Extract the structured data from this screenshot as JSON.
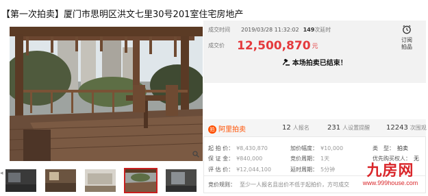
{
  "title": "【第一次拍卖】厦门市思明区洪文七里30号201室住宅房地产",
  "auction": {
    "time_label": "成交时间",
    "time_value": "2019/03/28 11:32:02",
    "delay_count": "149",
    "delay_label": "次延时",
    "price_label": "成交价",
    "price_value": "12,500,870",
    "price_unit": "元",
    "remind_line1": "订阅",
    "remind_line2": "拍品",
    "ended_text": "本场拍卖已结束！"
  },
  "platform": {
    "logo_text": "阿里拍卖",
    "signups_count": "12",
    "signups_label": "人报名",
    "reminders_count": "231",
    "reminders_label": "人设置提醒",
    "views_count": "12243",
    "views_label": "次围观"
  },
  "details": {
    "start_label": "起 拍 价：",
    "start_value": "¥8,430,870",
    "deposit_label": "保 证 金：",
    "deposit_value": "¥840,000",
    "appraise_label": "评 估 价：",
    "appraise_value": "¥12,044,100",
    "increment_label": "加价幅度：",
    "increment_value": "¥10,000",
    "cycle_label": "竞价周期：",
    "cycle_value": "1天",
    "delay_label": "延时周期：",
    "delay_value": "5分钟",
    "type_label": "类　型：",
    "type_value": "拍卖",
    "priority_label": "优先购买权人：",
    "priority_value": "无",
    "rule_label": "竞价规则：",
    "rule_value": "至少一人报名且出价不低于起拍价，方可成交"
  },
  "watermark": {
    "brand": "九房网",
    "url": "www.999house.com"
  },
  "colors": {
    "accent_red": "#e4393c",
    "ali_orange": "#ff5000",
    "watermark_red": "#d9262a"
  }
}
